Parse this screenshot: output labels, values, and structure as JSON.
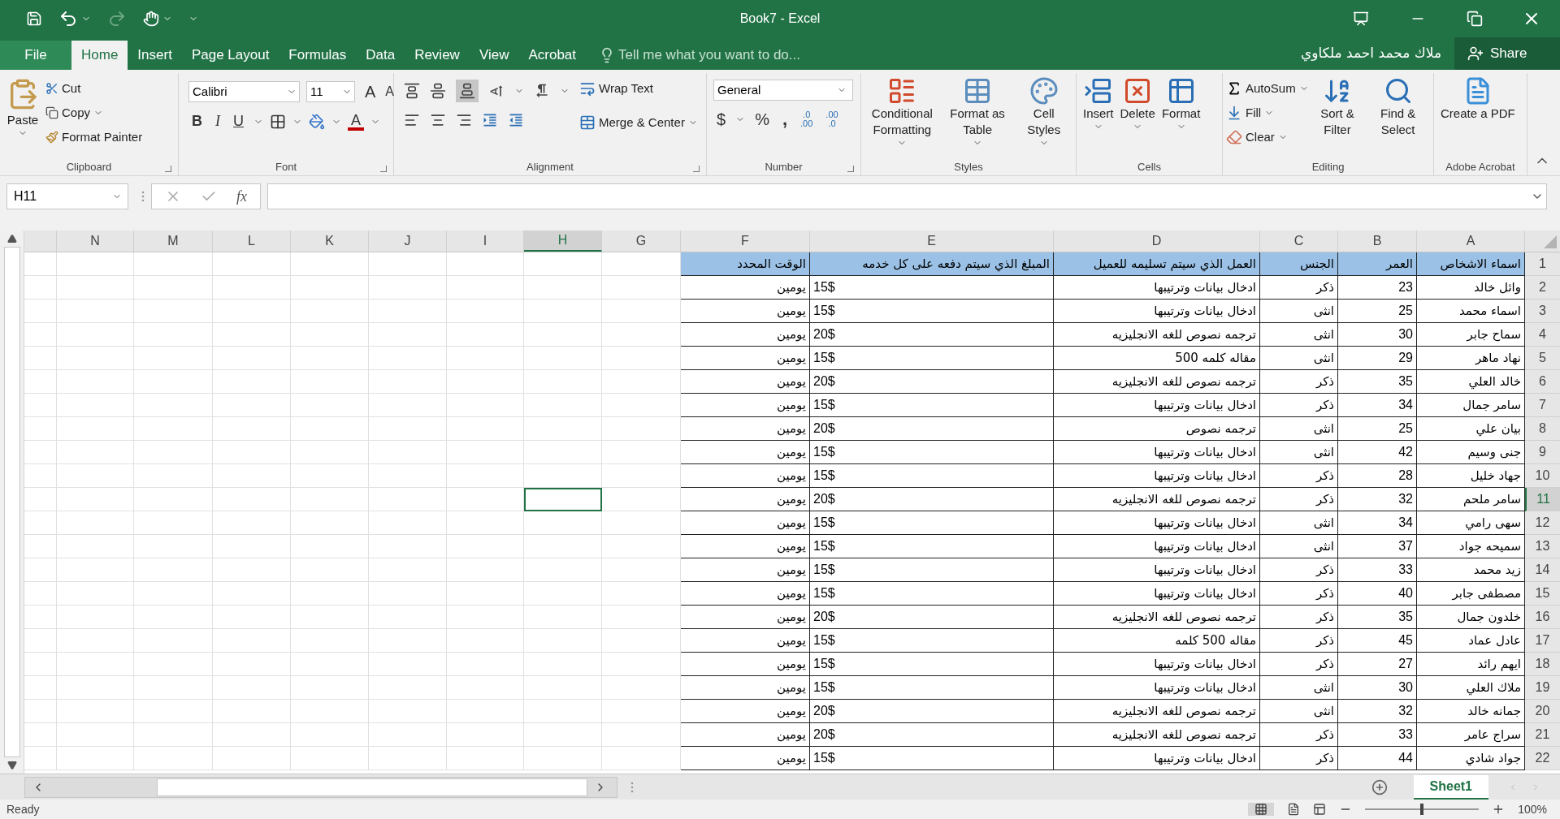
{
  "window": {
    "title": "Book7 - Excel"
  },
  "tabs": {
    "file": {
      "label": "File",
      "kind": "file",
      "selected": false
    },
    "home": {
      "label": "Home",
      "kind": "tab",
      "selected": true
    },
    "insert": {
      "label": "Insert",
      "kind": "tab",
      "selected": false
    },
    "page_layout": {
      "label": "Page Layout",
      "kind": "tab",
      "selected": false
    },
    "formulas": {
      "label": "Formulas",
      "kind": "tab",
      "selected": false
    },
    "data": {
      "label": "Data",
      "kind": "tab",
      "selected": false
    },
    "review": {
      "label": "Review",
      "kind": "tab",
      "selected": false
    },
    "view": {
      "label": "View",
      "kind": "tab",
      "selected": false
    },
    "acrobat": {
      "label": "Acrobat",
      "kind": "tab",
      "selected": false
    }
  },
  "tell_me": {
    "placeholder": "Tell me what you want to do..."
  },
  "user": "ملاك محمد احمد ملكاوي",
  "share": "Share",
  "ribbon": {
    "clipboard": {
      "label": "Clipboard",
      "paste": "Paste",
      "cut": "Cut",
      "copy": "Copy",
      "format_painter": "Format Painter"
    },
    "font": {
      "label": "Font",
      "font_name": "Calibri",
      "font_size": "11",
      "grow": "A",
      "shrink": "A",
      "bold": "B",
      "italic": "I",
      "underline": "U",
      "font_color": "A"
    },
    "alignment": {
      "label": "Alignment",
      "wrap_text": "Wrap Text",
      "merge_center": "Merge & Center"
    },
    "number": {
      "label": "Number",
      "format": "General",
      "currency": "$",
      "percent": "%",
      "comma": ",",
      "increase_decimal": [
        ".0",
        ".00"
      ],
      "decrease_decimal": [
        ".00",
        ".0"
      ]
    },
    "styles": {
      "label": "Styles",
      "conditional_formatting": "Conditional Formatting",
      "format_as_table": "Format as Table",
      "cell_styles": "Cell Styles"
    },
    "cells": {
      "label": "Cells",
      "insert": "Insert",
      "delete": "Delete",
      "format": "Format"
    },
    "editing": {
      "label": "Editing",
      "autosum": "AutoSum",
      "fill": "Fill",
      "clear": "Clear",
      "sort_filter": "Sort & Filter",
      "find_select": "Find & Select"
    },
    "acrobat": {
      "label": "Adobe Acrobat",
      "create_pdf": "Create a PDF"
    }
  },
  "formula_bar": {
    "name_box": "H11",
    "fx": "fx"
  },
  "columns": [
    {
      "label": "A",
      "selected": false
    },
    {
      "label": "B",
      "selected": false
    },
    {
      "label": "C",
      "selected": false
    },
    {
      "label": "D",
      "selected": false
    },
    {
      "label": "E",
      "selected": false
    },
    {
      "label": "F",
      "selected": false
    },
    {
      "label": "G",
      "selected": false
    },
    {
      "label": "H",
      "selected": true
    },
    {
      "label": "I",
      "selected": false
    },
    {
      "label": "J",
      "selected": false
    },
    {
      "label": "K",
      "selected": false
    },
    {
      "label": "L",
      "selected": false
    },
    {
      "label": "M",
      "selected": false
    },
    {
      "label": "N",
      "selected": false
    }
  ],
  "rows": [
    {
      "number": "1",
      "selected": false,
      "header": true,
      "cells": [
        "اسماء الاشخاص",
        "العمر",
        "الجنس",
        "العمل الذي سيتم تسليمه للعميل",
        "المبلغ الذي سيتم دفعه على كل خدمه",
        "الوقت المحدد"
      ]
    },
    {
      "number": "2",
      "selected": false,
      "header": false,
      "cells": [
        "وائل خالد",
        "23",
        "ذكر",
        "ادخال بيانات وترتيبها",
        "15$",
        "يومين"
      ]
    },
    {
      "number": "3",
      "selected": false,
      "header": false,
      "cells": [
        "اسماء محمد",
        "25",
        "انثى",
        "ادخال بيانات وترتيبها",
        "15$",
        "يومين"
      ]
    },
    {
      "number": "4",
      "selected": false,
      "header": false,
      "cells": [
        "سماح جابر",
        "30",
        "انثى",
        "ترجمه نصوص للغه الانجليزيه",
        "20$",
        "يومين"
      ]
    },
    {
      "number": "5",
      "selected": false,
      "header": false,
      "cells": [
        "نهاد ماهر",
        "29",
        "انثى",
        "مقاله كلمه 500",
        "15$",
        "يومين"
      ]
    },
    {
      "number": "6",
      "selected": false,
      "header": false,
      "cells": [
        "خالد العلي",
        "35",
        "ذكر",
        "ترجمه نصوص للغه الانجليزيه",
        "20$",
        "يومين"
      ]
    },
    {
      "number": "7",
      "selected": false,
      "header": false,
      "cells": [
        "سامر جمال",
        "34",
        "ذكر",
        "ادخال بيانات وترتيبها",
        "15$",
        "يومين"
      ]
    },
    {
      "number": "8",
      "selected": false,
      "header": false,
      "cells": [
        "بيان علي",
        "25",
        "انثى",
        "ترجمه نصوص",
        "20$",
        "يومين"
      ]
    },
    {
      "number": "9",
      "selected": false,
      "header": false,
      "cells": [
        "جنى وسيم",
        "42",
        "انثى",
        "ادخال بيانات وترتيبها",
        "15$",
        "يومين"
      ]
    },
    {
      "number": "10",
      "selected": false,
      "header": false,
      "cells": [
        "جهاد خليل",
        "28",
        "ذكر",
        "ادخال بيانات وترتيبها",
        "15$",
        "يومين"
      ]
    },
    {
      "number": "11",
      "selected": true,
      "header": false,
      "cells": [
        "سامر ملحم",
        "32",
        "ذكر",
        "ترجمه نصوص للغه الانجليزيه",
        "20$",
        "يومين"
      ]
    },
    {
      "number": "12",
      "selected": false,
      "header": false,
      "cells": [
        "سهى رامي",
        "34",
        "انثى",
        "ادخال بيانات وترتيبها",
        "15$",
        "يومين"
      ]
    },
    {
      "number": "13",
      "selected": false,
      "header": false,
      "cells": [
        "سميحه جواد",
        "37",
        "انثى",
        "ادخال بيانات وترتيبها",
        "15$",
        "يومين"
      ]
    },
    {
      "number": "14",
      "selected": false,
      "header": false,
      "cells": [
        "زيد محمد",
        "33",
        "ذكر",
        "ادخال بيانات وترتيبها",
        "15$",
        "يومين"
      ]
    },
    {
      "number": "15",
      "selected": false,
      "header": false,
      "cells": [
        "مصطفى جابر",
        "40",
        "ذكر",
        "ادخال بيانات وترتيبها",
        "15$",
        "يومين"
      ]
    },
    {
      "number": "16",
      "selected": false,
      "header": false,
      "cells": [
        "خلدون جمال",
        "35",
        "ذكر",
        "ترجمه نصوص للغه الانجليزيه",
        "20$",
        "يومين"
      ]
    },
    {
      "number": "17",
      "selected": false,
      "header": false,
      "cells": [
        "عادل عماد",
        "45",
        "ذكر",
        "مقاله 500 كلمه",
        "15$",
        "يومين"
      ]
    },
    {
      "number": "18",
      "selected": false,
      "header": false,
      "cells": [
        "ايهم رائد",
        "27",
        "ذكر",
        "ادخال بيانات وترتيبها",
        "15$",
        "يومين"
      ]
    },
    {
      "number": "19",
      "selected": false,
      "header": false,
      "cells": [
        "ملاك العلي",
        "30",
        "انثى",
        "ادخال بيانات وترتيبها",
        "15$",
        "يومين"
      ]
    },
    {
      "number": "20",
      "selected": false,
      "header": false,
      "cells": [
        "جمانه خالد",
        "32",
        "انثى",
        "ترجمه نصوص للغه الانجليزيه",
        "20$",
        "يومين"
      ]
    },
    {
      "number": "21",
      "selected": false,
      "header": false,
      "cells": [
        "سراج عامر",
        "33",
        "ذكر",
        "ترجمه نصوص للغه الانجليزيه",
        "20$",
        "يومين"
      ]
    },
    {
      "number": "22",
      "selected": false,
      "header": false,
      "cells": [
        "جواد شادي",
        "44",
        "ذكر",
        "ادخال بيانات وترتيبها",
        "15$",
        "يومين"
      ]
    }
  ],
  "sheets": [
    {
      "label": "Sheet1",
      "selected": true
    }
  ],
  "status_bar": {
    "status": "Ready",
    "zoom": {
      "level": 0.5,
      "reading": "100%"
    }
  }
}
